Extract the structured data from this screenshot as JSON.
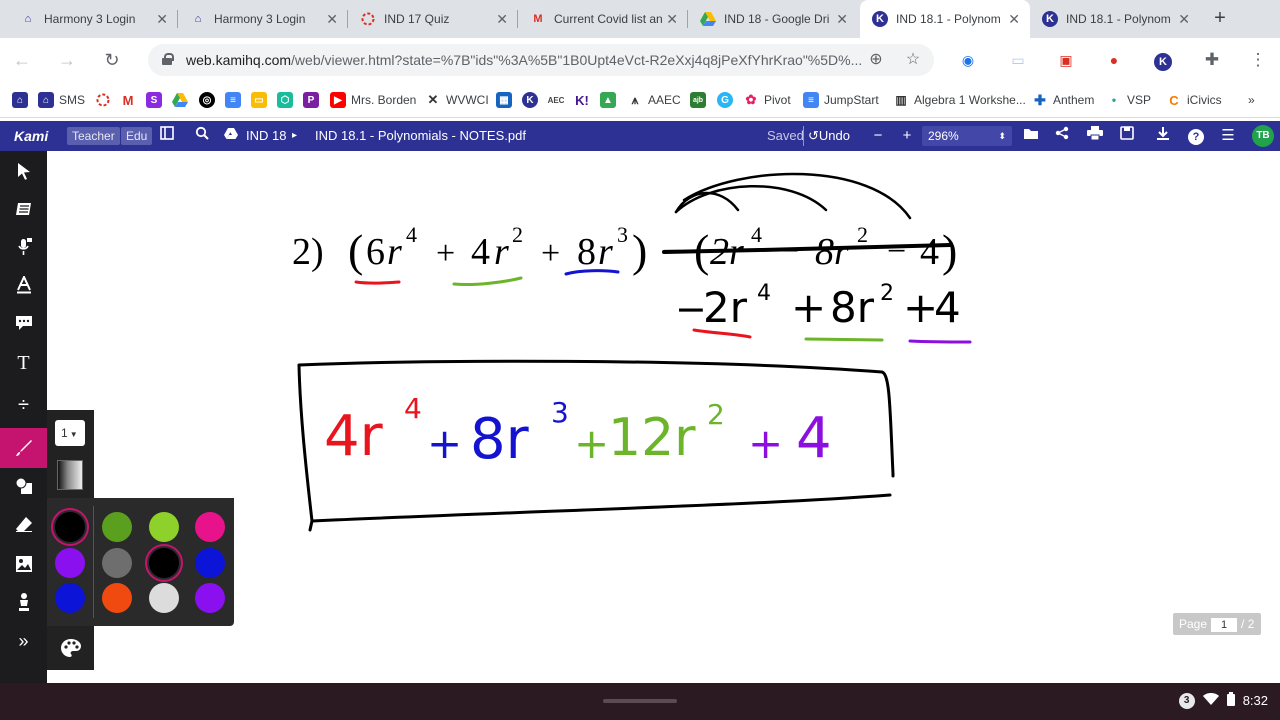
{
  "browser": {
    "tabs": [
      {
        "title": "Harmony 3 Login",
        "icon": "harmony-icon"
      },
      {
        "title": "Harmony 3 Login",
        "icon": "harmony-icon"
      },
      {
        "title": "IND 17 Quiz",
        "icon": "quiz-icon"
      },
      {
        "title": "Current Covid list an",
        "icon": "gmail-icon"
      },
      {
        "title": "IND 18 - Google Dri",
        "icon": "google-drive-icon"
      },
      {
        "title": "IND 18.1 - Polynom",
        "icon": "kami-icon",
        "active": true
      },
      {
        "title": "IND 18.1 - Polynom",
        "icon": "kami-icon"
      }
    ],
    "url_host": "web.kamihq.com",
    "url_rest": "/web/viewer.html?state=%7B\"ids\"%3A%5B\"1B0Upt4eVct-R2eXxj4q8jPeXfYhrKrao\"%5D%...",
    "bookmarks": [
      {
        "label": "SMS"
      },
      {
        "label": "Mrs. Borden"
      },
      {
        "label": "WVWCI"
      },
      {
        "label": "AAEC"
      },
      {
        "label": "Pivot"
      },
      {
        "label": "JumpStart"
      },
      {
        "label": "Algebra 1 Workshe..."
      },
      {
        "label": "Anthem"
      },
      {
        "label": "VSP"
      },
      {
        "label": "iCivics"
      }
    ],
    "more_bookmarks": "»"
  },
  "kami": {
    "logo": "Kami",
    "role_teacher": "Teacher",
    "role_edu": "Edu",
    "breadcrumb_folder": "IND 18",
    "breadcrumb_sep": "▸",
    "filename": "IND 18.1 - Polynomials - NOTES.pdf",
    "saved": "Saved",
    "undo": "Undo",
    "zoom_out": "−",
    "zoom_in": "+",
    "zoom": "296%",
    "user_initials": "TB"
  },
  "pen_panel": {
    "size": "1",
    "colors": [
      "#000000",
      "#5aa01e",
      "#8fd12b",
      "#e8138b",
      "#8b10f0",
      "#6e6e6e",
      "#000000",
      "#0c14d8",
      "#0c14d8",
      "#f04a10",
      "#dcdcdc",
      "#8b10f0"
    ],
    "selected_indices": [
      0,
      6
    ]
  },
  "document": {
    "problem_number": "2)",
    "term1_coef": "6",
    "term1_var": "r",
    "term1_exp": "4",
    "op1": "+",
    "term2_coef": "4",
    "term2_var": "r",
    "term2_exp": "2",
    "op2": "+",
    "term3_coef": "8",
    "term3_var": "r",
    "term3_exp": "3",
    "minus": "−",
    "p2_term1": "2r",
    "p2_term1_exp": "4",
    "p2_op1": "−",
    "p2_term2": "8r",
    "p2_term2_exp": "2",
    "p2_op2": "−",
    "p2_term3": "4",
    "handwritten_line2": {
      "t1_sign": "−",
      "t1": "2r",
      "t1_exp": "4",
      "t2_sign": "+",
      "t2": "8r",
      "t2_exp": "2",
      "t3_sign": "+",
      "t3": "4"
    },
    "answer": {
      "t1": "4r",
      "t1_exp": "4",
      "t2_sign": "+",
      "t2": "8r",
      "t2_exp": "3",
      "t3_sign": "+",
      "t3": "12r",
      "t3_exp": "2",
      "t4_sign": "+",
      "t4": "4"
    },
    "ink_colors": {
      "red": "#e8141e",
      "green": "#6cb52a",
      "blue": "#1414d0",
      "purple": "#8b10e0",
      "black": "#000000"
    }
  },
  "page_indicator": {
    "label": "Page",
    "current": "1",
    "total": "/ 2"
  },
  "shelf": {
    "notification_count": "3",
    "time": "8:32"
  }
}
